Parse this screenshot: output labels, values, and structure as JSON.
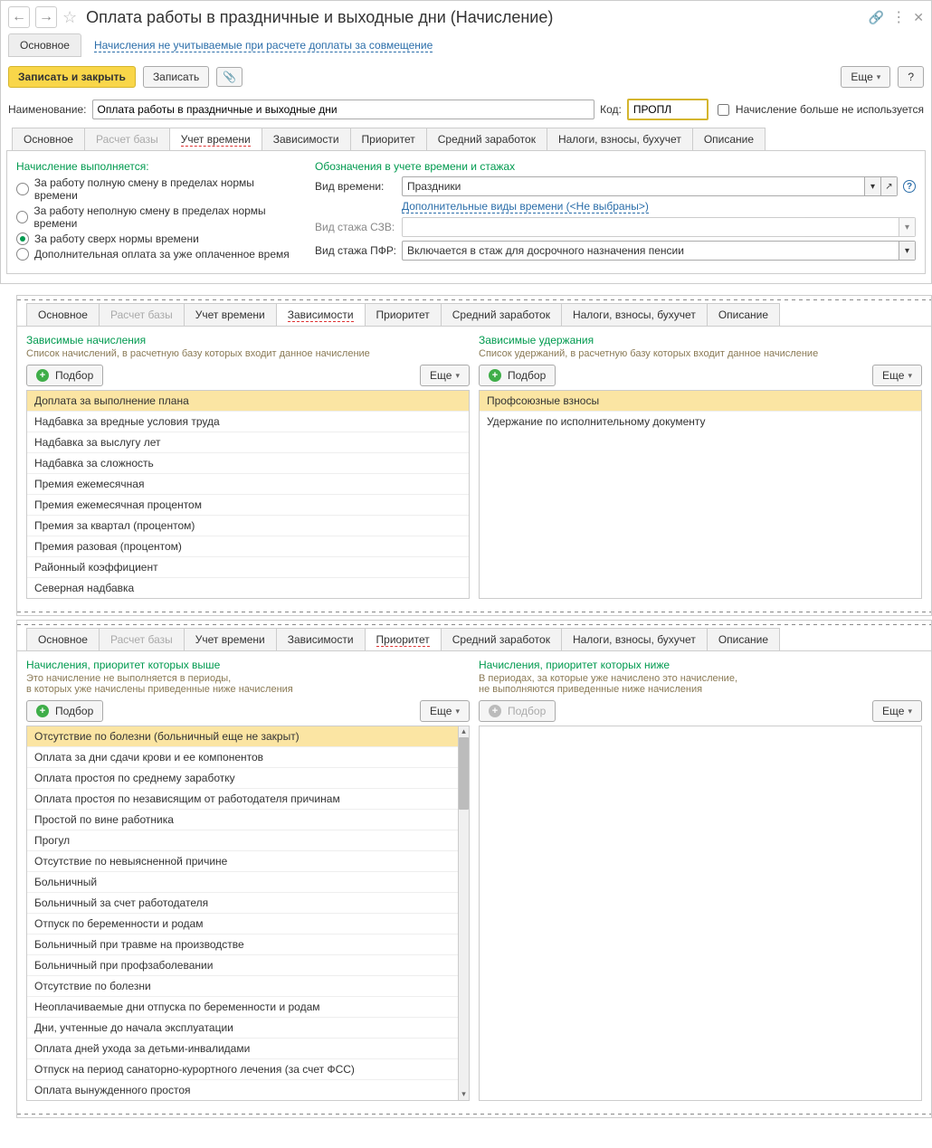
{
  "header": {
    "title": "Оплата работы в праздничные и выходные дни (Начисление)"
  },
  "topNav": {
    "tab": "Основное",
    "link": "Начисления не учитываемые при расчете доплаты за совмещение"
  },
  "toolbar": {
    "primary": "Записать и закрыть",
    "save": "Записать",
    "more": "Еще",
    "help": "?"
  },
  "form": {
    "name_label": "Наименование:",
    "name_value": "Оплата работы в праздничные и выходные дни",
    "code_label": "Код:",
    "code_value": "ПРОПЛ",
    "unused_label": "Начисление больше не используется"
  },
  "mainTabs": {
    "t1": "Основное",
    "t2": "Расчет базы",
    "t3": "Учет времени",
    "t4": "Зависимости",
    "t5": "Приоритет",
    "t6": "Средний заработок",
    "t7": "Налоги, взносы, бухучет",
    "t8": "Описание"
  },
  "timeTab": {
    "left_title": "Начисление выполняется:",
    "r1": "За работу полную смену в пределах нормы времени",
    "r2": "За работу неполную смену в пределах нормы времени",
    "r3": "За работу сверх нормы времени",
    "r4": "Дополнительная оплата за уже оплаченное время",
    "right_title": "Обозначения в учете времени и стажах",
    "f_timekind": "Вид времени:",
    "f_timekind_val": "Праздники",
    "extra_times_link": "Дополнительные виды времени (<Не выбраны>)",
    "f_szv": "Вид стажа СЗВ:",
    "f_szv_val": "",
    "f_pfr": "Вид стажа ПФР:",
    "f_pfr_val": "Включается в стаж для досрочного назначения пенсии"
  },
  "dep": {
    "left_title": "Зависимые начисления",
    "left_sub": "Список начислений, в расчетную базу которых входит данное начисление",
    "right_title": "Зависимые удержания",
    "right_sub": "Список удержаний, в расчетную базу которых входит данное начисление",
    "pick": "Подбор",
    "more": "Еще",
    "left_rows": [
      "Доплата за выполнение плана",
      "Надбавка за вредные условия труда",
      "Надбавка за выслугу лет",
      "Надбавка за сложность",
      "Премия ежемесячная",
      "Премия ежемесячная процентом",
      "Премия за квартал (процентом)",
      "Премия разовая (процентом)",
      "Районный коэффициент",
      "Северная надбавка"
    ],
    "right_rows": [
      "Профсоюзные взносы",
      "Удержание по исполнительному документу"
    ]
  },
  "prio": {
    "left_title": "Начисления, приоритет которых выше",
    "left_sub1": "Это начисление не выполняется в периоды,",
    "left_sub2": "в которых уже начислены приведенные ниже начисления",
    "right_title": "Начисления, приоритет которых ниже",
    "right_sub1": "В периодах, за которые уже начислено это начисление,",
    "right_sub2": "не выполняются приведенные ниже начисления",
    "pick": "Подбор",
    "more": "Еще",
    "rows": [
      "Отсутствие по болезни (больничный еще не закрыт)",
      "Оплата за дни сдачи крови и ее компонентов",
      "Оплата простоя по среднему заработку",
      "Оплата простоя по независящим от работодателя причинам",
      "Простой по вине работника",
      "Прогул",
      "Отсутствие по невыясненной причине",
      "Больничный",
      "Больничный за счет работодателя",
      "Отпуск по беременности и родам",
      "Больничный при травме на производстве",
      "Больничный при профзаболевании",
      "Отсутствие по болезни",
      "Неоплачиваемые дни отпуска по беременности и родам",
      "Дни, учтенные до начала эксплуатации",
      "Оплата дней ухода за детьми-инвалидами",
      "Отпуск на период санаторно-курортного лечения (за счет ФСС)",
      "Оплата вынужденного простоя"
    ]
  }
}
